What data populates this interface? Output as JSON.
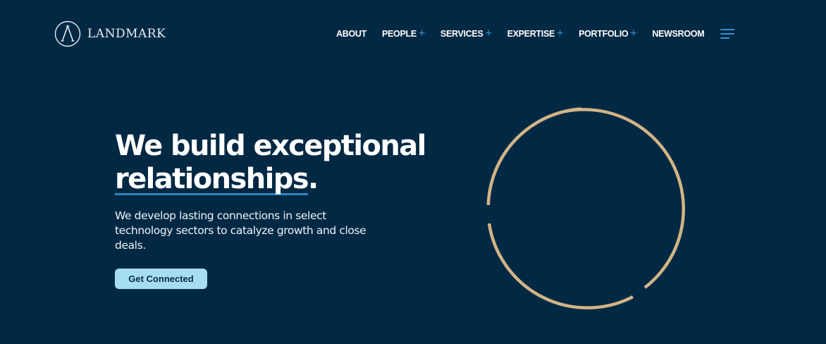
{
  "brand": {
    "name": "LANDMARK",
    "logo_icon": "landmark-a-monogram-icon"
  },
  "nav": {
    "items": [
      {
        "label": "ABOUT",
        "expandable": false
      },
      {
        "label": "PEOPLE",
        "expandable": true
      },
      {
        "label": "SERVICES",
        "expandable": true
      },
      {
        "label": "EXPERTISE",
        "expandable": true
      },
      {
        "label": "PORTFOLIO",
        "expandable": true
      },
      {
        "label": "NEWSROOM",
        "expandable": false
      }
    ],
    "expand_symbol": "+",
    "menu_icon": "hamburger-menu-icon"
  },
  "hero": {
    "title_line1": "We build exceptional",
    "title_line2": "relationships",
    "title_period": ".",
    "subtitle": "We develop lasting connections in select technology sectors to catalyze growth and close deals.",
    "cta_label": "Get Connected"
  },
  "colors": {
    "background": "#022944",
    "accent_blue": "#3b8fd1",
    "ring_gold": "#d3b485",
    "cta_bg": "#a6def1",
    "cta_text": "#0b2a45"
  }
}
